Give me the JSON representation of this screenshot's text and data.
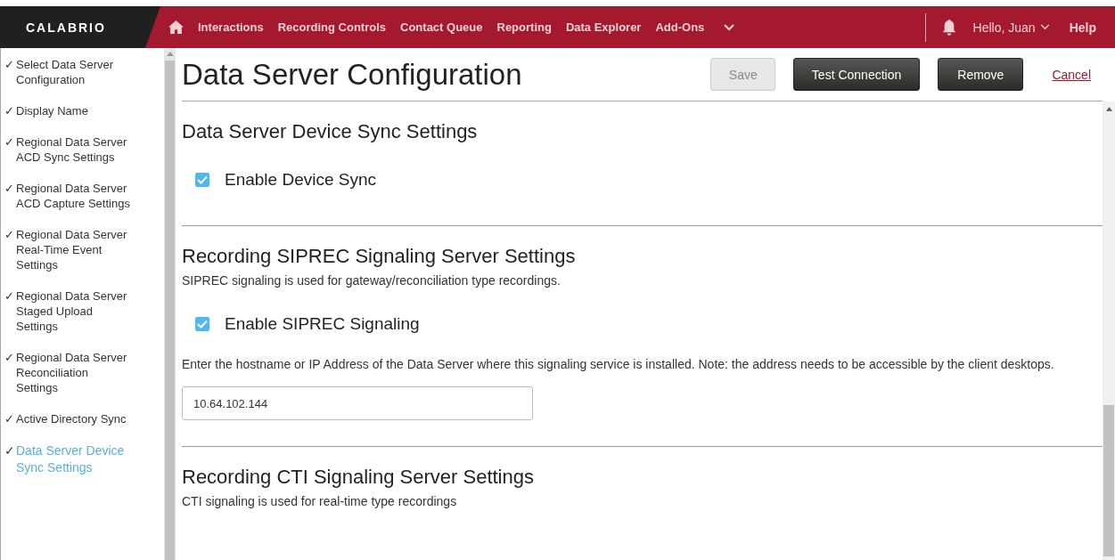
{
  "header": {
    "logo": "CALABRIO",
    "nav": [
      "Interactions",
      "Recording Controls",
      "Contact Queue",
      "Reporting",
      "Data Explorer",
      "Add-Ons"
    ],
    "user": "Hello, Juan",
    "help": "Help"
  },
  "sidebar": {
    "items": [
      {
        "label": "Select Data Server Configuration",
        "selected": false
      },
      {
        "label": "Display Name",
        "selected": false
      },
      {
        "label": "Regional Data Server ACD Sync Settings",
        "selected": false
      },
      {
        "label": "Regional Data Server ACD Capture Settings",
        "selected": false
      },
      {
        "label": "Regional Data Server Real-Time Event Settings",
        "selected": false
      },
      {
        "label": "Regional Data Server Staged Upload Settings",
        "selected": false
      },
      {
        "label": "Regional Data Server Reconciliation Settings",
        "selected": false
      },
      {
        "label": "Active Directory Sync",
        "selected": false
      },
      {
        "label": "Data Server Device Sync Settings",
        "selected": true
      }
    ],
    "check": "✓"
  },
  "page": {
    "title": "Data Server Configuration",
    "buttons": [
      {
        "label": "Save",
        "disabled": true
      },
      {
        "label": "Test Connection",
        "disabled": false
      },
      {
        "label": "Remove",
        "disabled": false
      }
    ],
    "cancel": "Cancel"
  },
  "sections": [
    {
      "title": "Data Server Device Sync Settings",
      "items": [
        {
          "kind": "checkbox",
          "label": "Enable Device Sync",
          "checked": true
        }
      ]
    },
    {
      "title": "Recording SIPREC Signaling Server Settings",
      "description": "SIPREC signaling is used for gateway/reconciliation type recordings.",
      "items": [
        {
          "kind": "checkbox",
          "label": "Enable SIPREC Signaling",
          "checked": true
        },
        {
          "kind": "note",
          "text": "Enter the hostname or IP Address of the Data Server where this signaling service is installed. Note: the address needs to be accessible by the client desktops."
        },
        {
          "kind": "field",
          "value": "10.64.102.144"
        }
      ]
    },
    {
      "title": "Recording CTI Signaling Server Settings",
      "description": "CTI signaling is used for real-time type recordings"
    }
  ]
}
